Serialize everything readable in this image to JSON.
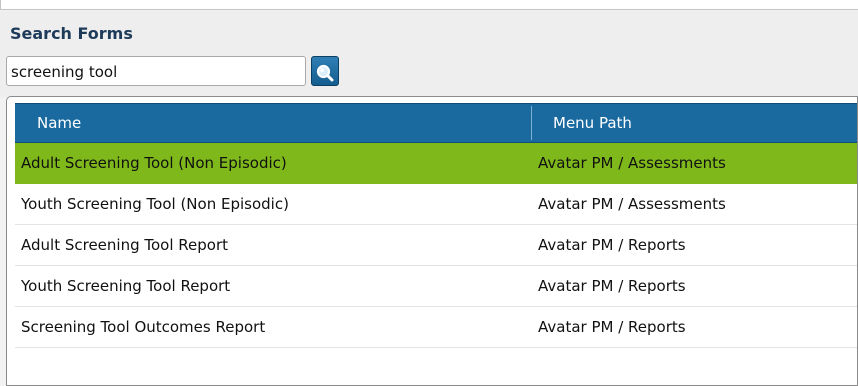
{
  "search": {
    "label": "Search Forms",
    "value": "screening tool",
    "button_icon": "search-icon"
  },
  "grid": {
    "columns": [
      "Name",
      "Menu Path"
    ],
    "rows": [
      {
        "name": "Adult Screening Tool (Non Episodic)",
        "path": "Avatar PM / Assessments",
        "selected": true
      },
      {
        "name": "Youth Screening Tool (Non Episodic)",
        "path": "Avatar PM / Assessments",
        "selected": false
      },
      {
        "name": "Adult Screening Tool Report",
        "path": "Avatar PM / Reports",
        "selected": false
      },
      {
        "name": "Youth Screening Tool Report",
        "path": "Avatar PM / Reports",
        "selected": false
      },
      {
        "name": "Screening Tool Outcomes Report",
        "path": "Avatar PM / Reports",
        "selected": false
      }
    ]
  },
  "colors": {
    "header_bg": "#1a6aa0",
    "selected_row": "#7fb81b",
    "label_text": "#1d3b59"
  }
}
